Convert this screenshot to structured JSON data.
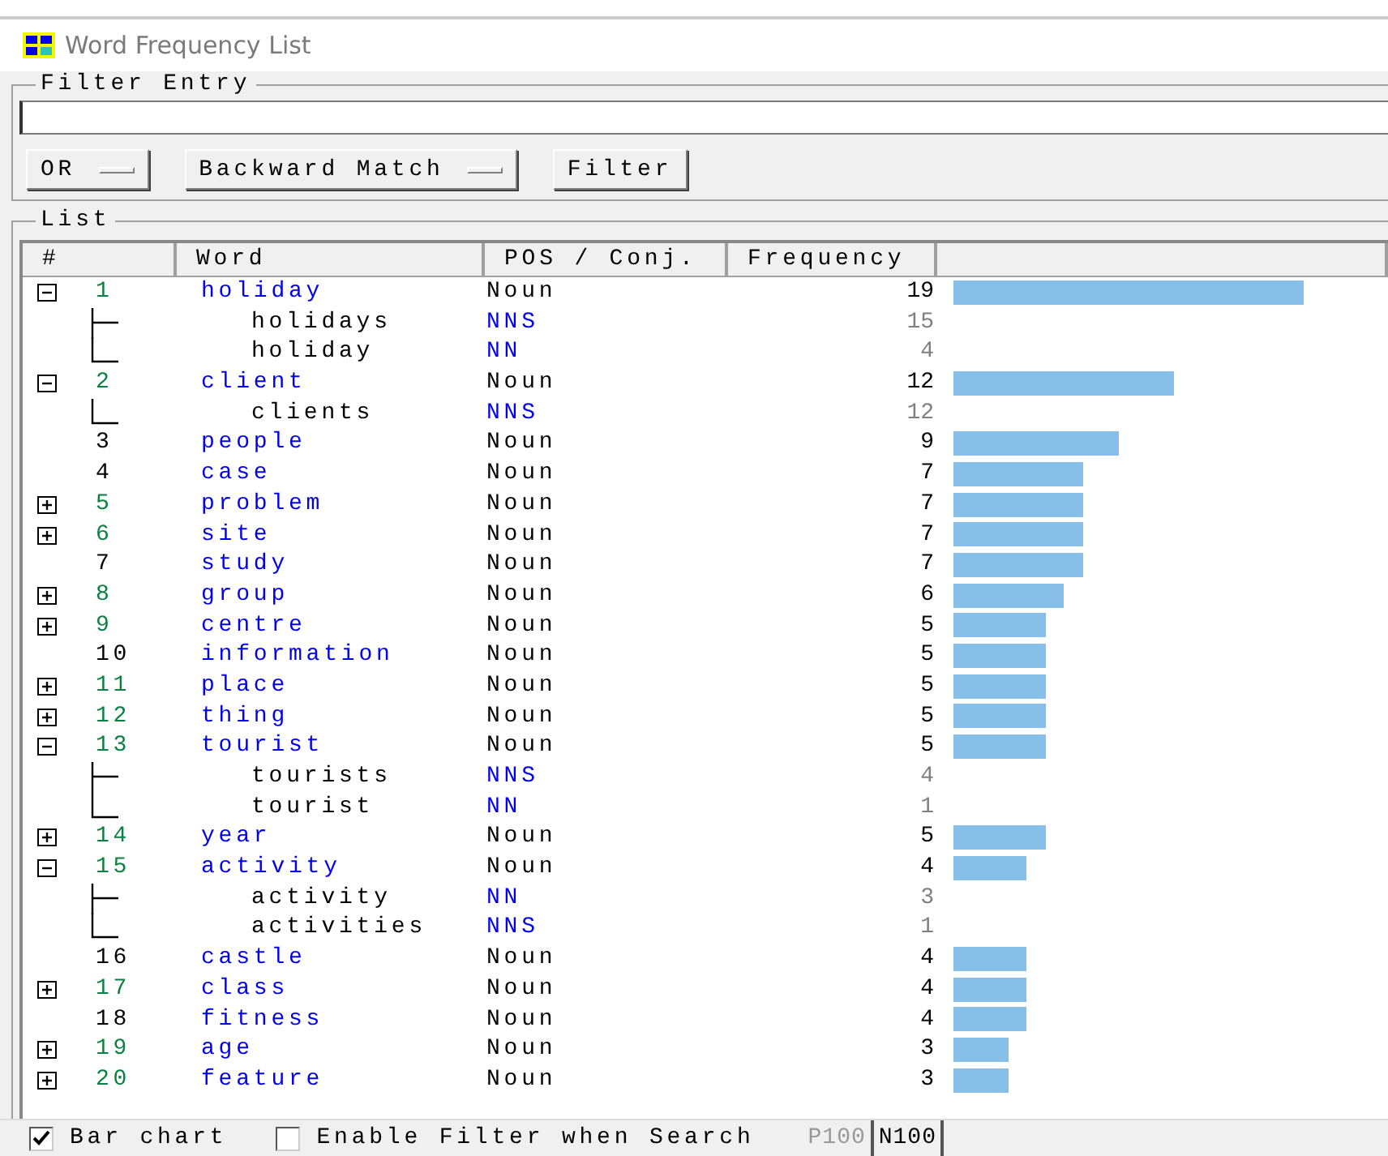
{
  "window": {
    "title": "Word Frequency List"
  },
  "filter_entry": {
    "label": "Filter Entry",
    "mode": "OR",
    "match": "Backward Match",
    "button": "Filter"
  },
  "list": {
    "label": "List",
    "columns": [
      "#",
      "Word",
      "POS / Conj.",
      "Frequency"
    ],
    "rows": [
      {
        "kind": "group",
        "expanded": true,
        "num": "1",
        "word": "holiday",
        "pos": "Noun",
        "freq": "19",
        "children": [
          {
            "word": "holidays",
            "pos": "NNS",
            "freq": "15"
          },
          {
            "word": "holiday",
            "pos": "NN",
            "freq": "4"
          }
        ]
      },
      {
        "kind": "group",
        "expanded": true,
        "num": "2",
        "word": "client",
        "pos": "Noun",
        "freq": "12",
        "children": [
          {
            "word": "clients",
            "pos": "NNS",
            "freq": "12"
          }
        ]
      },
      {
        "kind": "single",
        "num": "3",
        "word": "people",
        "pos": "Noun",
        "freq": "9"
      },
      {
        "kind": "single",
        "num": "4",
        "word": "case",
        "pos": "Noun",
        "freq": "7"
      },
      {
        "kind": "group",
        "expanded": false,
        "num": "5",
        "word": "problem",
        "pos": "Noun",
        "freq": "7"
      },
      {
        "kind": "group",
        "expanded": false,
        "num": "6",
        "word": "site",
        "pos": "Noun",
        "freq": "7"
      },
      {
        "kind": "single",
        "num": "7",
        "word": "study",
        "pos": "Noun",
        "freq": "7"
      },
      {
        "kind": "group",
        "expanded": false,
        "num": "8",
        "word": "group",
        "pos": "Noun",
        "freq": "6"
      },
      {
        "kind": "group",
        "expanded": false,
        "num": "9",
        "word": "centre",
        "pos": "Noun",
        "freq": "5"
      },
      {
        "kind": "single",
        "num": "10",
        "word": "information",
        "pos": "Noun",
        "freq": "5"
      },
      {
        "kind": "group",
        "expanded": false,
        "num": "11",
        "word": "place",
        "pos": "Noun",
        "freq": "5"
      },
      {
        "kind": "group",
        "expanded": false,
        "num": "12",
        "word": "thing",
        "pos": "Noun",
        "freq": "5"
      },
      {
        "kind": "group",
        "expanded": true,
        "num": "13",
        "word": "tourist",
        "pos": "Noun",
        "freq": "5",
        "children": [
          {
            "word": "tourists",
            "pos": "NNS",
            "freq": "4"
          },
          {
            "word": "tourist",
            "pos": "NN",
            "freq": "1"
          }
        ]
      },
      {
        "kind": "group",
        "expanded": false,
        "num": "14",
        "word": "year",
        "pos": "Noun",
        "freq": "5"
      },
      {
        "kind": "group",
        "expanded": true,
        "num": "15",
        "word": "activity",
        "pos": "Noun",
        "freq": "4",
        "children": [
          {
            "word": "activity",
            "pos": "NN",
            "freq": "3"
          },
          {
            "word": "activities",
            "pos": "NNS",
            "freq": "1"
          }
        ]
      },
      {
        "kind": "single",
        "num": "16",
        "word": "castle",
        "pos": "Noun",
        "freq": "4"
      },
      {
        "kind": "group",
        "expanded": false,
        "num": "17",
        "word": "class",
        "pos": "Noun",
        "freq": "4"
      },
      {
        "kind": "single",
        "num": "18",
        "word": "fitness",
        "pos": "Noun",
        "freq": "4"
      },
      {
        "kind": "group",
        "expanded": false,
        "num": "19",
        "word": "age",
        "pos": "Noun",
        "freq": "3"
      },
      {
        "kind": "group",
        "expanded": false,
        "num": "20",
        "word": "feature",
        "pos": "Noun",
        "freq": "3"
      }
    ]
  },
  "status_bar": {
    "options": [
      {
        "label": "Bar chart",
        "checked": true
      },
      {
        "label": "Enable Filter when Search",
        "checked": false
      }
    ],
    "pages": [
      {
        "label": "P100",
        "disabled": true
      },
      {
        "label": "N100",
        "disabled": false
      }
    ]
  }
}
